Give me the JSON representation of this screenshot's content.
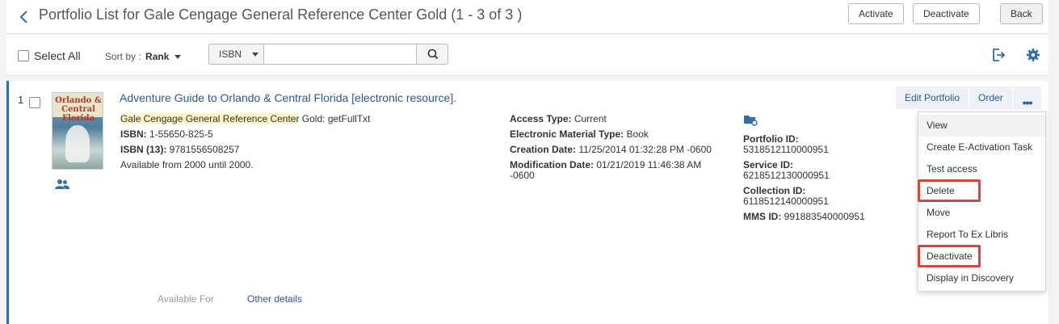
{
  "header": {
    "title": "Portfolio List for Gale Cengage General Reference Center Gold (1 - 3 of 3 )",
    "activate_label": "Activate",
    "deactivate_label": "Deactivate",
    "back_label": "Back"
  },
  "toolbar": {
    "select_all_label": "Select All",
    "sort_by_label": "Sort by :",
    "sort_by_value": "Rank",
    "search_field_value": "ISBN",
    "search_value": ""
  },
  "record": {
    "number": "1",
    "thumbnail_title": "Orlando & Central Florida",
    "title": "Adventure Guide to Orlando & Central Florida [electronic resource].",
    "collection_highlight": "Gale Cengage General Reference Center",
    "collection_suffix": " Gold: getFullTxt",
    "isbn_label": "ISBN:",
    "isbn_value": " 1-55650-825-5",
    "isbn13_label": "ISBN (13):",
    "isbn13_value": " 9781556508257",
    "availability": "Available from 2000 until 2000.",
    "access_type_label": "Access Type:",
    "access_type_value": " Current",
    "material_type_label": "Electronic Material Type:",
    "material_type_value": " Book",
    "creation_date_label": "Creation Date:",
    "creation_date_value": " 11/25/2014 01:32:28 PM -0600",
    "modification_date_label": "Modification Date:",
    "modification_date_value": " 01/21/2019 11:46:38 AM -0600",
    "portfolio_id_label": "Portfolio ID:",
    "portfolio_id_value": "5318512110000951",
    "service_id_label": "Service ID:",
    "service_id_value": "6218512130000951",
    "collection_id_label": "Collection ID:",
    "collection_id_value": "6118512140000951",
    "mms_id_label": "MMS ID:",
    "mms_id_value": " 991883540000951",
    "available_for_label": "Available For",
    "other_details_label": "Other details",
    "edit_portfolio_label": "Edit Portfolio",
    "order_label": "Order",
    "more_label": "•••"
  },
  "menu": {
    "items": [
      "View",
      "Create E-Activation Task",
      "Test access",
      "Delete",
      "Move",
      "Report To Ex Libris",
      "Deactivate",
      "Display in Discovery"
    ]
  },
  "colors": {
    "link": "#2b5797",
    "highlight_box": "#d9433b",
    "record_accent": "#2f6ea8"
  }
}
